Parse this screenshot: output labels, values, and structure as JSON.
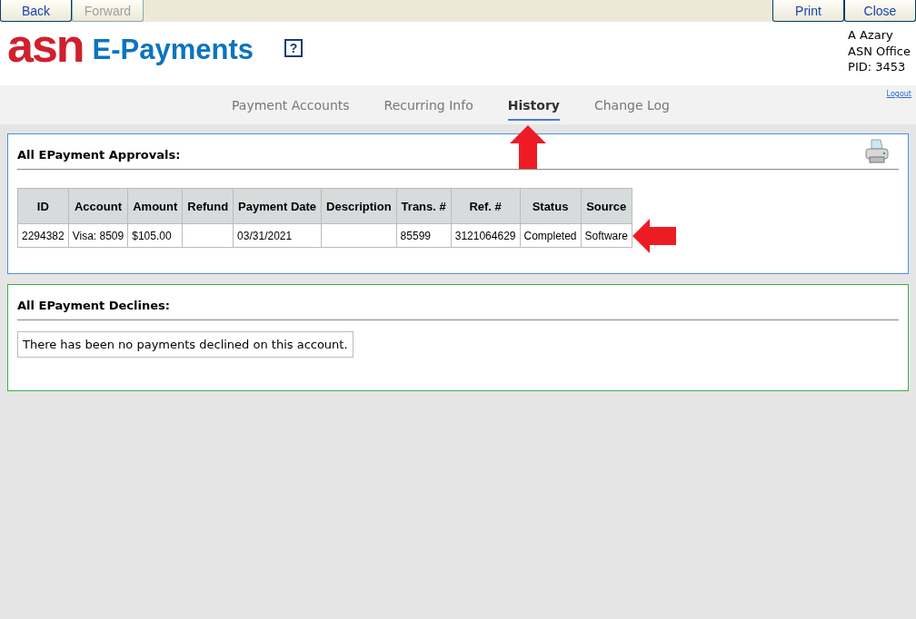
{
  "toolbar": {
    "left": [
      {
        "label": "Back",
        "disabled": false
      },
      {
        "label": "Forward",
        "disabled": true
      }
    ],
    "right": [
      {
        "label": "Print",
        "disabled": false
      },
      {
        "label": "Close",
        "disabled": false
      }
    ]
  },
  "header": {
    "logo_mark": "asn",
    "logo_text": "E-Payments",
    "help": "?",
    "user": [
      "A Azary",
      "ASN Office",
      "PID: 3453"
    ],
    "logout": "Logout"
  },
  "tabs": [
    {
      "label": "Payment Accounts",
      "selected": false
    },
    {
      "label": "Recurring Info",
      "selected": false
    },
    {
      "label": "History",
      "selected": true
    },
    {
      "label": "Change Log",
      "selected": false
    }
  ],
  "approvals": {
    "title": "All EPayment Approvals:",
    "columns": [
      "ID",
      "Account",
      "Amount",
      "Refund",
      "Payment Date",
      "Description",
      "Trans. #",
      "Ref. #",
      "Status",
      "Source"
    ],
    "rows": [
      [
        "2294382",
        "Visa: 8509",
        "$105.00",
        "",
        "03/31/2021",
        "",
        "85599",
        "3121064629",
        "Completed",
        "Software"
      ]
    ]
  },
  "declines": {
    "title": "All EPayment Declines:",
    "message": "There has been no payments declined on this account."
  }
}
